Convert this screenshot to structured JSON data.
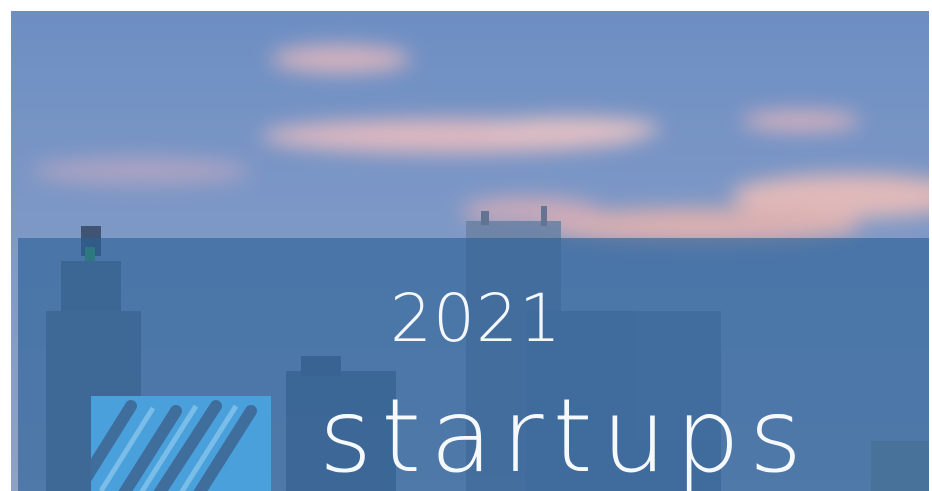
{
  "banner": {
    "year": "2021",
    "title": "startups"
  },
  "colors": {
    "overlay": "#2b6296",
    "logo_blue": "#4aa0db",
    "text": "#f6f9fc"
  },
  "icons": {
    "logo": "diagonal-stripes-logo"
  }
}
